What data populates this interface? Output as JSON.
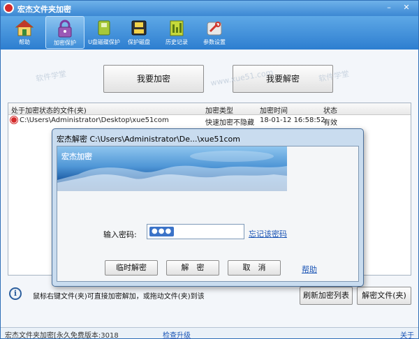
{
  "window": {
    "title": "宏杰文件夹加密"
  },
  "toolbar": {
    "items": [
      {
        "label": "帮助",
        "icon": "house-icon"
      },
      {
        "label": "加密保护",
        "icon": "lock-icon"
      },
      {
        "label": "U盘磁碟保护",
        "icon": "usb-drive-icon"
      },
      {
        "label": "保护磁盘",
        "icon": "disk-icon"
      },
      {
        "label": "历史记录",
        "icon": "history-icon"
      },
      {
        "label": "参数设置",
        "icon": "wrench-icon"
      }
    ]
  },
  "main": {
    "encrypt_button": "我要加密",
    "decrypt_button": "我要解密",
    "watermarks": [
      "软件学堂",
      "www.xue51.com",
      "软件学堂"
    ]
  },
  "list": {
    "columns": [
      "处于加密状态的文件(夹)",
      "加密类型",
      "加密时间",
      "状态"
    ],
    "rows": [
      {
        "path": "C:\\Users\\Administrator\\Desktop\\xue51com",
        "type": "快速加密不隐藏",
        "time": "18-01-12 16:58:52",
        "status": "有效"
      }
    ]
  },
  "footer": {
    "hint": "鼠标右键文件(夹)可直接加密解加，或拖动文件(夹)到该",
    "refresh_button": "刷新加密列表",
    "decrypt_file_button": "解密文件(夹)"
  },
  "statusbar": {
    "version": "宏杰文件夹加密[永久免费版本:3018",
    "check_update": "检查升级",
    "about": "关于"
  },
  "dialog": {
    "title": "宏杰解密 C:\\Users\\Administrator\\De...\\xue51com",
    "banner_brand": "宏杰加密",
    "password_label": "输入密码:",
    "password_mask": "●●●",
    "forgot_link": "忘记该密码",
    "temp_decrypt_button": "临时解密",
    "decrypt_button": "解　密",
    "cancel_button": "取　消",
    "help_link": "帮助"
  },
  "colors": {
    "titlebar": "#3c88d3",
    "toolbar": "#2d7ed0",
    "dialog_frame": "#c9dcef",
    "link": "#1b55b5"
  }
}
